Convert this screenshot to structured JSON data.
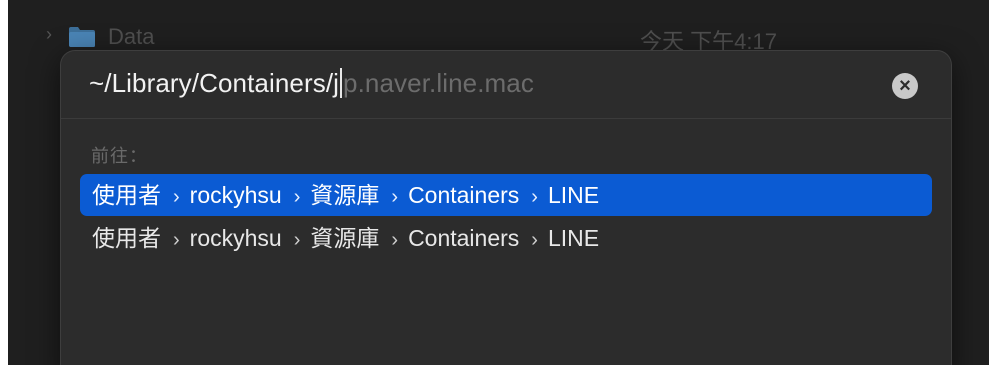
{
  "background_row": {
    "name": "Data",
    "date": "今天 下午4:17"
  },
  "dialog": {
    "path_typed": "~/Library/Containers/j",
    "path_suggestion": "p.naver.line.mac",
    "clear_icon": "clear-x-icon",
    "go_to_label": "前往：",
    "results": [
      {
        "segments": [
          "使用者",
          "rockyhsu",
          "資源庫",
          "Containers",
          "LINE"
        ],
        "selected": true
      },
      {
        "segments": [
          "使用者",
          "rockyhsu",
          "資源庫",
          "Containers",
          "LINE"
        ],
        "selected": false
      }
    ],
    "separator": "›"
  },
  "colors": {
    "selection": "#0b5bd3",
    "sheet_bg": "#2c2c2c",
    "window_bg": "#1f1f1f"
  }
}
